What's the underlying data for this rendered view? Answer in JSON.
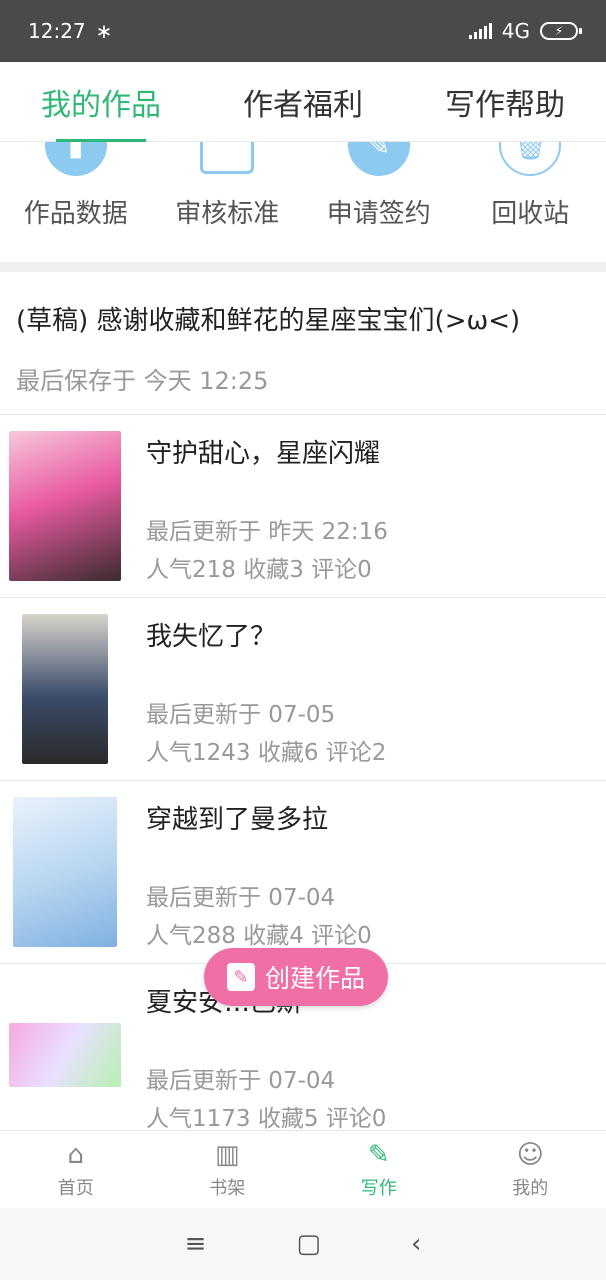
{
  "status_bar": {
    "time": "12:27",
    "bluetooth": "∗",
    "network": "4G"
  },
  "top_tabs": [
    {
      "label": "我的作品",
      "active": true
    },
    {
      "label": "作者福利",
      "active": false
    },
    {
      "label": "写作帮助",
      "active": false
    }
  ],
  "quick_actions": [
    {
      "label": "作品数据",
      "icon": "chart-icon"
    },
    {
      "label": "审核标准",
      "icon": "document-stamp-icon"
    },
    {
      "label": "申请签约",
      "icon": "sign-icon"
    },
    {
      "label": "回收站",
      "icon": "trash-icon"
    }
  ],
  "draft": {
    "title": "(草稿) 感谢收藏和鲜花的星座宝宝们(>ω<)",
    "saved": "最后保存于 今天 12:25"
  },
  "works": [
    {
      "title": "守护甜心，星座闪耀",
      "updated": "最后更新于 昨天 22:16",
      "stats": "人气218 收藏3 评论0"
    },
    {
      "title": "我失忆了？",
      "updated": "最后更新于 07-05",
      "stats": "人气1243 收藏6 评论2"
    },
    {
      "title": "穿越到了曼多拉",
      "updated": "最后更新于 07-04",
      "stats": "人气288 收藏4 评论0"
    },
    {
      "title": "夏安安…巴斯",
      "updated": "最后更新于 07-04",
      "stats": "人气1173 收藏5 评论0"
    }
  ],
  "fab": {
    "label": "创建作品"
  },
  "bottom_nav": [
    {
      "label": "首页",
      "icon": "home-icon",
      "active": false
    },
    {
      "label": "书架",
      "icon": "bookshelf-icon",
      "active": false
    },
    {
      "label": "写作",
      "icon": "pen-icon",
      "active": true
    },
    {
      "label": "我的",
      "icon": "user-icon",
      "active": false
    }
  ],
  "colors": {
    "accent": "#2fb877",
    "fab": "#f06fa7",
    "icon_blue": "#8ccaf0"
  }
}
